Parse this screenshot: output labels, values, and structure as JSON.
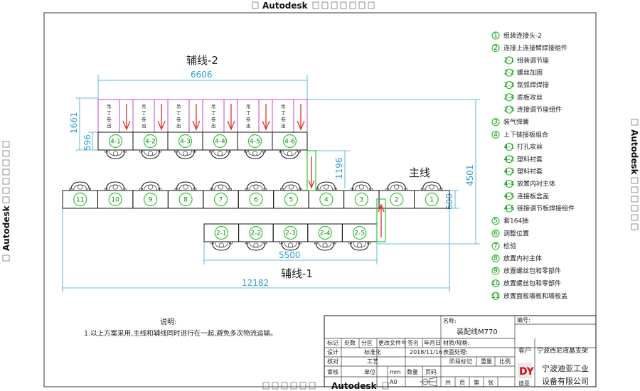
{
  "watermark": {
    "text": "Autodesk"
  },
  "titles": {
    "aux2": "辅线-2",
    "main": "主线",
    "aux1": "辅线-1"
  },
  "dims": {
    "d6606": "6606",
    "d1661": "1661",
    "d596": "596",
    "d1196": "1196",
    "d4501": "4501",
    "d600": "600",
    "d5500": "5500",
    "d12182": "12182"
  },
  "stations": {
    "aux2": [
      "4-1",
      "4-2",
      "4-3",
      "4-4",
      "4-5",
      "4-6"
    ],
    "main": [
      "11",
      "10",
      "9",
      "8",
      "7",
      "6",
      "5",
      "4",
      "3",
      "2",
      "1"
    ],
    "aux1": [
      "2-1",
      "2-2",
      "2-3",
      "2-4",
      "2-5"
    ]
  },
  "shelf_label": "吊\n丁\n卷\n出",
  "legend": [
    {
      "n": "1",
      "t": "组装连接头-2",
      "sub": false
    },
    {
      "n": "2",
      "t": "连接上连接臂焊接组件",
      "sub": false
    },
    {
      "n": "2-1",
      "t": "组装调节座",
      "sub": true
    },
    {
      "n": "2-2",
      "t": "螺丝加固",
      "sub": true
    },
    {
      "n": "2-3",
      "t": "氩弧焊焊接",
      "sub": true
    },
    {
      "n": "2-4",
      "t": "底板攻丝",
      "sub": true
    },
    {
      "n": "2-5",
      "t": "连接调节座组件",
      "sub": true
    },
    {
      "n": "3",
      "t": "装气弹簧",
      "sub": false
    },
    {
      "n": "4",
      "t": "上下链接板组合",
      "sub": false
    },
    {
      "n": "4-1",
      "t": "打孔攻丝",
      "sub": true
    },
    {
      "n": "4-2",
      "t": "塑料衬套",
      "sub": true
    },
    {
      "n": "4-3",
      "t": "塑料衬套",
      "sub": true
    },
    {
      "n": "4-4",
      "t": "放置内衬主体",
      "sub": true
    },
    {
      "n": "4-5",
      "t": "连接板盒盖",
      "sub": true
    },
    {
      "n": "4-6",
      "t": "链接调节板焊接组件",
      "sub": true
    },
    {
      "n": "5",
      "t": "套164抽",
      "sub": false
    },
    {
      "n": "6",
      "t": "调整位置",
      "sub": false
    },
    {
      "n": "7",
      "t": "检验",
      "sub": false
    },
    {
      "n": "8",
      "t": "放置内衬主体",
      "sub": false
    },
    {
      "n": "9",
      "t": "放置螺丝包和零部件",
      "sub": false
    },
    {
      "n": "10",
      "t": "放置螺丝包和零部件",
      "sub": false
    },
    {
      "n": "11",
      "t": "放置面板墙板和墙板盖",
      "sub": false
    }
  ],
  "notes": {
    "title": "说明:",
    "line1": "1.以上方案采用,主线和辅线同时进行在一起,避免多次物流运输。"
  },
  "title_block": {
    "name_label": "名称:",
    "name": "装配线M770",
    "code_label": "编号:",
    "row1": [
      "标记",
      "处数",
      "分区",
      "更改文件号",
      "签名",
      "年月日"
    ],
    "row2": [
      "设计",
      "",
      "标准化",
      ""
    ],
    "date": "2018/11/16",
    "material_label": "材质/规格:",
    "surface_label": "表面处理:",
    "client_label": "客户",
    "client": "宁波西尼液晶支架",
    "row3": [
      "核对",
      "",
      "工艺",
      "",
      "",
      "",
      "阶段标记",
      "重量",
      "比例"
    ],
    "row4": [
      "审核",
      "",
      "单位",
      "mm",
      "数量",
      "页码"
    ],
    "row5": [
      "",
      "",
      "",
      "A0",
      "",
      "共",
      "页",
      "第",
      "张"
    ],
    "company_logo": "DY",
    "company_sub": "迪亚",
    "company1": "宁波迪亚工业",
    "company2": "设备有限公司"
  }
}
